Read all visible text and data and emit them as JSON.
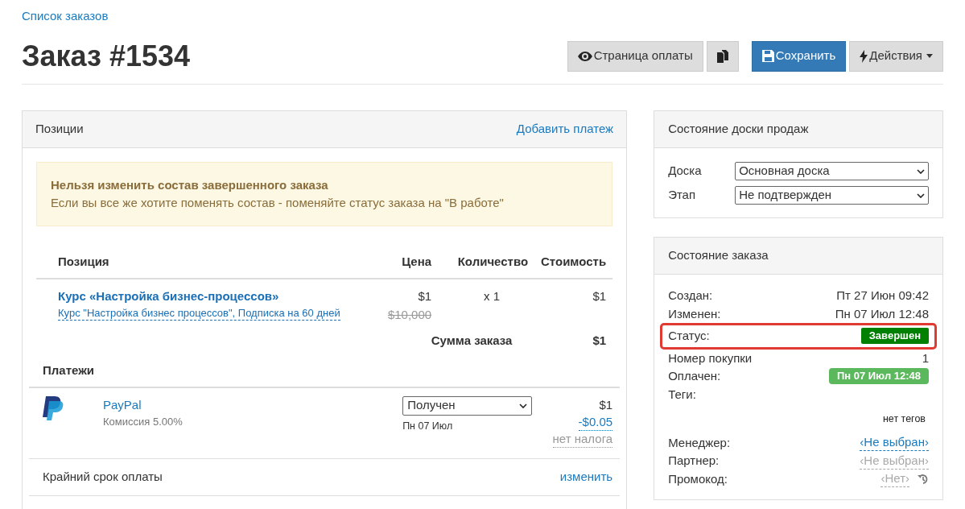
{
  "breadcrumb": "Список заказов",
  "title": "Заказ #1534",
  "toolbar": [
    {
      "kind": "eye",
      "label": "Страница оплаты",
      "primary": false
    },
    {
      "kind": "copy",
      "primary": false
    },
    {
      "kind": "save",
      "label": "Сохранить",
      "primary": true
    },
    {
      "kind": "bolt",
      "label": "Действия",
      "primary": false
    }
  ],
  "items_panel": {
    "title": "Позиции",
    "action": "Добавить платеж",
    "alert": {
      "title": "Нельзя изменить состав завершенного заказа",
      "text": "Если вы все же хотите поменять состав - поменяйте статус заказа на \"В работе\""
    },
    "columns": [
      "Позиция",
      "Цена",
      "Количество",
      "Стоимость"
    ],
    "rows": [
      {
        "name": "Курс «Настройка бизнес-процессов»",
        "subtitle": "Курс \"Настройка бизнес процессов\", Подписка на 60 дней",
        "price": "$1",
        "old_price": "$10,000",
        "quantity": "x 1",
        "cost": "$1"
      }
    ],
    "total_label": "Сумма заказа",
    "total": "$1",
    "payments_title": "Платежи",
    "payments": [
      {
        "name": "PayPal",
        "commission": "Комиссия 5.00%",
        "status": "Получен",
        "date": "Пн 07 Июл",
        "amount": "$1",
        "fee": "-$0.05",
        "tax": "нет налога"
      }
    ],
    "deadline_label": "Крайний срок оплаты",
    "deadline_action": "изменить"
  },
  "board_panel": {
    "title": "Состояние доски продаж",
    "fields": [
      {
        "label": "Доска",
        "value": "Основная доска"
      },
      {
        "label": "Этап",
        "value": "Не подтвержден"
      }
    ]
  },
  "order_panel": {
    "title": "Состояние заказа",
    "rows": [
      {
        "label": "Создан:",
        "kind": "text",
        "value": "Пт 27 Июн 09:42",
        "highlighted": false
      },
      {
        "label": "Изменен:",
        "kind": "text",
        "value": "Пн 07 Июл 12:48",
        "highlighted": false
      },
      {
        "label": "Статус:",
        "kind": "badge",
        "value": "Завершен",
        "color": "#008000",
        "highlighted": true
      },
      {
        "label": "Номер покупки",
        "kind": "text",
        "value": "1",
        "highlighted": false
      },
      {
        "label": "Оплачен:",
        "kind": "badge",
        "value": "Пн 07 Июл 12:48",
        "color": "#5cb85c",
        "highlighted": false
      },
      {
        "label": "Теги:",
        "kind": "tags",
        "value": "нет тегов",
        "highlighted": false
      },
      {
        "label": "Менеджер:",
        "kind": "link",
        "value": "‹Не выбран›",
        "highlighted": false
      },
      {
        "label": "Партнер:",
        "kind": "muted",
        "value": "‹Не выбран›",
        "highlighted": false
      },
      {
        "label": "Промокод:",
        "kind": "muted-history",
        "value": "‹Нет›",
        "highlighted": false
      }
    ]
  }
}
